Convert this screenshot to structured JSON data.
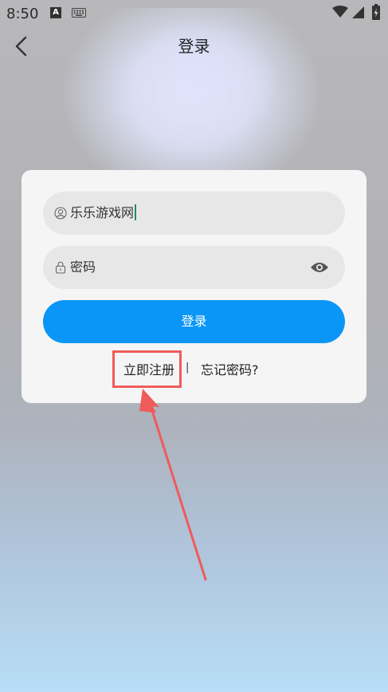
{
  "status_bar": {
    "time": "8:50",
    "notification_icon_letter": "A",
    "icons": [
      "notification-a-icon",
      "keyboard-icon",
      "wifi-icon",
      "signal-icon",
      "battery-charging-icon"
    ]
  },
  "header": {
    "title": "登录",
    "back_icon": "back-chevron-icon"
  },
  "login_form": {
    "username": {
      "value": "乐乐游戏网",
      "icon": "user-circle-icon"
    },
    "password": {
      "placeholder": "密码",
      "icon": "lock-icon",
      "toggle_icon": "eye-icon"
    },
    "login_button": "登录",
    "register_link": "立即注册",
    "separator": "|",
    "forgot_link": "忘记密码?"
  },
  "annotation": {
    "highlight_color": "#ef5b5b",
    "target": "register-link"
  },
  "colors": {
    "primary_button": "#0a96f6",
    "card_bg": "#f5f5f5",
    "field_bg": "#e7e7e7"
  }
}
